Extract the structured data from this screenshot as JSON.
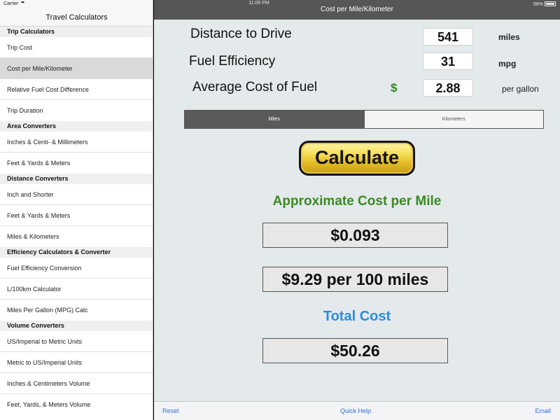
{
  "status_bar": {
    "carrier": "Carrier",
    "time": "11:06 PM",
    "battery": "98%"
  },
  "sidebar": {
    "title": "Travel Calculators",
    "sections": [
      {
        "header": "Trip Calculators",
        "items": [
          "Trip Cost",
          "Cost per Mile/Kilometer",
          "Relative Fuel Cost Difference",
          "Trip Duration"
        ]
      },
      {
        "header": "Area Converters",
        "items": [
          "Inches & Centi- & Millimeters",
          "Feet & Yards & Meters"
        ]
      },
      {
        "header": "Distance Converters",
        "items": [
          "Inch and Shorter",
          "Feet & Yards & Meters",
          "Miles & Kilometers"
        ]
      },
      {
        "header": "Efficiency Calculators & Converter",
        "items": [
          "Fuel Efficiency Conversion",
          "L/100km Calculator",
          "Miles Per Gallon (MPG) Calc"
        ]
      },
      {
        "header": "Volume Converters",
        "items": [
          "US/Imperial to Metric Units",
          "Metric to US/Imperial Units",
          "Inches & Centimeters Volume",
          "Feet, Yards, & Meters Volume"
        ]
      }
    ],
    "selected": "Cost per Mile/Kilometer"
  },
  "main": {
    "nav_title": "Cost per Mile/Kilometer",
    "inputs": {
      "distance": {
        "label": "Distance to Drive",
        "value": "541",
        "unit": "miles"
      },
      "efficiency": {
        "label": "Fuel Efficiency",
        "value": "31",
        "unit": "mpg"
      },
      "fuel_cost": {
        "label": "Average Cost of Fuel",
        "currency": "$",
        "value": "2.88",
        "unit": "per gallon"
      }
    },
    "segments": [
      {
        "label": "Miles",
        "active": true
      },
      {
        "label": "Kilometers",
        "active": false
      }
    ],
    "calculate_label": "Calculate",
    "cost_per_heading": "Approximate Cost per Mile",
    "cost_per_value": "$0.093",
    "cost_per_100": "$9.29 per 100 miles",
    "total_heading": "Total Cost",
    "total_value": "$50.26"
  },
  "toolbar": {
    "reset": "Reset",
    "quick_help": "Quick Help",
    "email": "Email"
  },
  "colors": {
    "green": "#3a8a20",
    "blue": "#2a8de0",
    "link": "#2f6fdc",
    "nav": "#565656",
    "button_gold": "#e2bd25"
  }
}
